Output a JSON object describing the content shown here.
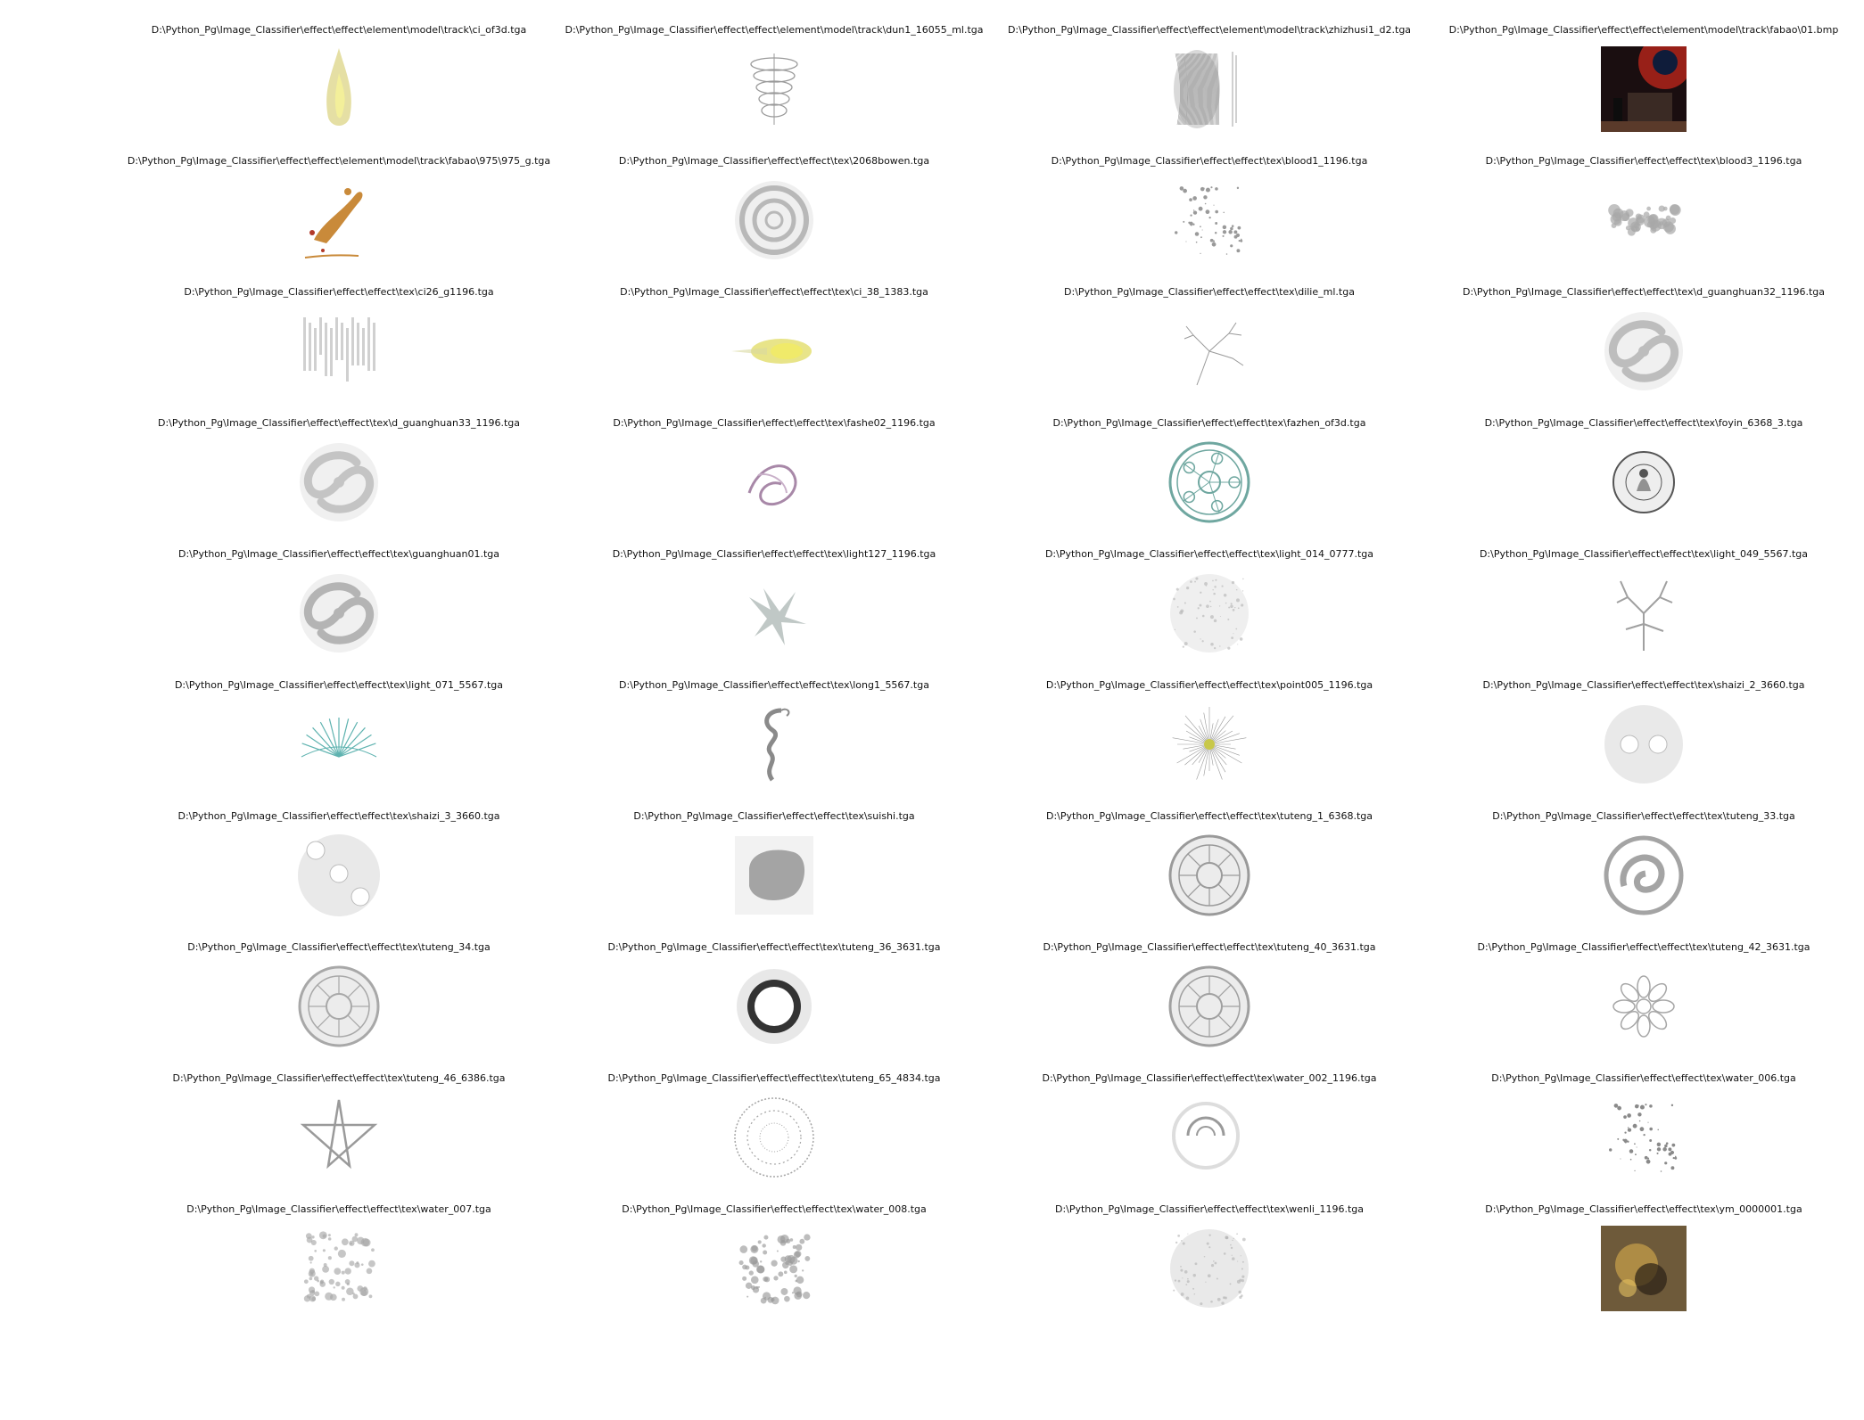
{
  "captions": [
    "D:\\Python_Pg\\Image_Classifier\\effect\\effect\\element\\model\\track\\ci_of3d.tga",
    "D:\\Python_Pg\\Image_Classifier\\effect\\effect\\element\\model\\track\\dun1_16055_ml.tga",
    "D:\\Python_Pg\\Image_Classifier\\effect\\effect\\element\\model\\track\\zhizhusi1_d2.tga",
    "D:\\Python_Pg\\Image_Classifier\\effect\\effect\\element\\model\\track\\fabao\\01.bmp",
    "D:\\Python_Pg\\Image_Classifier\\effect\\effect\\element\\model\\track\\fabao\\975\\975_g.tga",
    "D:\\Python_Pg\\Image_Classifier\\effect\\effect\\tex\\2068bowen.tga",
    "D:\\Python_Pg\\Image_Classifier\\effect\\effect\\tex\\blood1_1196.tga",
    "D:\\Python_Pg\\Image_Classifier\\effect\\effect\\tex\\blood3_1196.tga",
    "D:\\Python_Pg\\Image_Classifier\\effect\\effect\\tex\\ci26_g1196.tga",
    "D:\\Python_Pg\\Image_Classifier\\effect\\effect\\tex\\ci_38_1383.tga",
    "D:\\Python_Pg\\Image_Classifier\\effect\\effect\\tex\\dilie_ml.tga",
    "D:\\Python_Pg\\Image_Classifier\\effect\\effect\\tex\\d_guanghuan32_1196.tga",
    "D:\\Python_Pg\\Image_Classifier\\effect\\effect\\tex\\d_guanghuan33_1196.tga",
    "D:\\Python_Pg\\Image_Classifier\\effect\\effect\\tex\\fashe02_1196.tga",
    "D:\\Python_Pg\\Image_Classifier\\effect\\effect\\tex\\fazhen_of3d.tga",
    "D:\\Python_Pg\\Image_Classifier\\effect\\effect\\tex\\foyin_6368_3.tga",
    "D:\\Python_Pg\\Image_Classifier\\effect\\effect\\tex\\guanghuan01.tga",
    "D:\\Python_Pg\\Image_Classifier\\effect\\effect\\tex\\light127_1196.tga",
    "D:\\Python_Pg\\Image_Classifier\\effect\\effect\\tex\\light_014_0777.tga",
    "D:\\Python_Pg\\Image_Classifier\\effect\\effect\\tex\\light_049_5567.tga",
    "D:\\Python_Pg\\Image_Classifier\\effect\\effect\\tex\\light_071_5567.tga",
    "D:\\Python_Pg\\Image_Classifier\\effect\\effect\\tex\\long1_5567.tga",
    "D:\\Python_Pg\\Image_Classifier\\effect\\effect\\tex\\point005_1196.tga",
    "D:\\Python_Pg\\Image_Classifier\\effect\\effect\\tex\\shaizi_2_3660.tga",
    "D:\\Python_Pg\\Image_Classifier\\effect\\effect\\tex\\shaizi_3_3660.tga",
    "D:\\Python_Pg\\Image_Classifier\\effect\\effect\\tex\\suishi.tga",
    "D:\\Python_Pg\\Image_Classifier\\effect\\effect\\tex\\tuteng_1_6368.tga",
    "D:\\Python_Pg\\Image_Classifier\\effect\\effect\\tex\\tuteng_33.tga",
    "D:\\Python_Pg\\Image_Classifier\\effect\\effect\\tex\\tuteng_34.tga",
    "D:\\Python_Pg\\Image_Classifier\\effect\\effect\\tex\\tuteng_36_3631.tga",
    "D:\\Python_Pg\\Image_Classifier\\effect\\effect\\tex\\tuteng_40_3631.tga",
    "D:\\Python_Pg\\Image_Classifier\\effect\\effect\\tex\\tuteng_42_3631.tga",
    "D:\\Python_Pg\\Image_Classifier\\effect\\effect\\tex\\tuteng_46_6386.tga",
    "D:\\Python_Pg\\Image_Classifier\\effect\\effect\\tex\\tuteng_65_4834.tga",
    "D:\\Python_Pg\\Image_Classifier\\effect\\effect\\tex\\water_002_1196.tga",
    "D:\\Python_Pg\\Image_Classifier\\effect\\effect\\tex\\water_006.tga",
    "D:\\Python_Pg\\Image_Classifier\\effect\\effect\\tex\\water_007.tga",
    "D:\\Python_Pg\\Image_Classifier\\effect\\effect\\tex\\water_008.tga",
    "D:\\Python_Pg\\Image_Classifier\\effect\\effect\\tex\\wenli_1196.tga",
    "D:\\Python_Pg\\Image_Classifier\\effect\\effect\\tex\\ym_0000001.tga"
  ],
  "thumbnails": [
    {
      "kind": "flame",
      "color": "#cfc45a"
    },
    {
      "kind": "ornament",
      "color": "#9a9a9a"
    },
    {
      "kind": "strands",
      "color": "#8a8a8a"
    },
    {
      "kind": "photo",
      "color": "#6a1510"
    },
    {
      "kind": "splash",
      "color": "#c98a3a"
    },
    {
      "kind": "rings",
      "color": "#b8b8b8"
    },
    {
      "kind": "specks",
      "color": "#9a9a9a"
    },
    {
      "kind": "cloud",
      "color": "#a8a8a8"
    },
    {
      "kind": "streaks",
      "color": "#b0b0b0"
    },
    {
      "kind": "beam",
      "color": "#d9d23a"
    },
    {
      "kind": "cracks",
      "color": "#9a9a9a"
    },
    {
      "kind": "swirl",
      "color": "#bdbdbd"
    },
    {
      "kind": "swirl",
      "color": "#c4c4c4"
    },
    {
      "kind": "wisp",
      "color": "#a888a8"
    },
    {
      "kind": "circle",
      "color": "#6fa7a0"
    },
    {
      "kind": "seal",
      "color": "#555555"
    },
    {
      "kind": "swirl",
      "color": "#b4b4b4"
    },
    {
      "kind": "lightning",
      "color": "#8d9a98"
    },
    {
      "kind": "haze",
      "color": "#d0d0d0"
    },
    {
      "kind": "branch",
      "color": "#a0a0a0"
    },
    {
      "kind": "fan",
      "color": "#5fb3b0"
    },
    {
      "kind": "dragon",
      "color": "#8a8a8a"
    },
    {
      "kind": "burst",
      "color": "#c8c84a"
    },
    {
      "kind": "dots2",
      "color": "#d4d4d4"
    },
    {
      "kind": "dots3",
      "color": "#d4d4d4"
    },
    {
      "kind": "blob",
      "color": "#8a8a8a"
    },
    {
      "kind": "medallion",
      "color": "#9a9a9a"
    },
    {
      "kind": "dragonring",
      "color": "#a4a4a4"
    },
    {
      "kind": "medallion",
      "color": "#a8a8a8"
    },
    {
      "kind": "sun",
      "color": "#333333"
    },
    {
      "kind": "medallion",
      "color": "#a0a0a0"
    },
    {
      "kind": "flower",
      "color": "#a6a6a6"
    },
    {
      "kind": "star",
      "color": "#9a9a9a"
    },
    {
      "kind": "dottedcircle",
      "color": "#a6a6a6"
    },
    {
      "kind": "ripple",
      "color": "#9a9a9a"
    },
    {
      "kind": "specks",
      "color": "#8a8a8a"
    },
    {
      "kind": "mottled",
      "color": "#a8a8a8"
    },
    {
      "kind": "mottled",
      "color": "#9a9a9a"
    },
    {
      "kind": "haze",
      "color": "#bfbfbf"
    },
    {
      "kind": "photo2",
      "color": "#6e5a3a"
    }
  ]
}
